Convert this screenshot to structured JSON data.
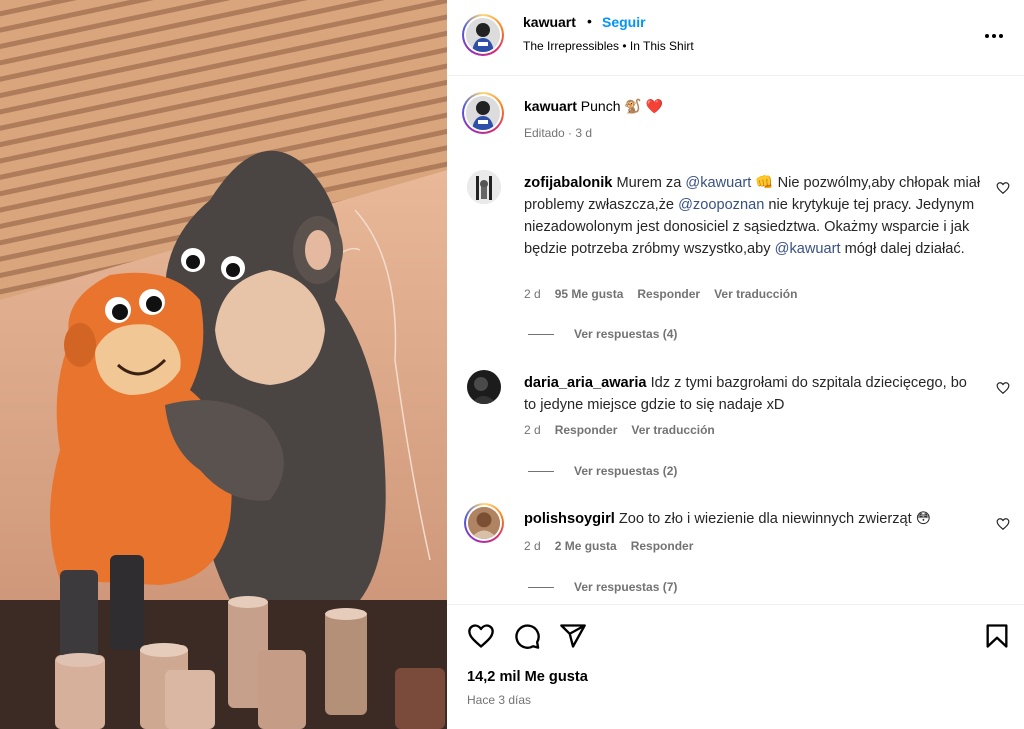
{
  "post": {
    "author": "kawuart",
    "follow_label": "Seguir",
    "separator": "•",
    "audio": "The Irrepressibles • In This Shirt",
    "more_icon": "more-horizontal-icon"
  },
  "caption": {
    "user": "kawuart",
    "text": " Punch 🐒 ❤️",
    "meta": "Editado · 3 d"
  },
  "comments": [
    {
      "user": "zofijabalonik",
      "segments": [
        {
          "t": " Murem za ",
          "m": false
        },
        {
          "t": "@kawuart",
          "m": true
        },
        {
          "t": " 👊 Nie pozwólmy,aby chłopak miał problemy zwłaszcza,że ",
          "m": false
        },
        {
          "t": "@zoopoznan",
          "m": true
        },
        {
          "t": " nie krytykuje tej pracy. Jedynym niezadowolonym jest donosiciel z sąsiedztwa. Okażmy wsparcie i jak będzie potrzeba zróbmy wszystko,aby ",
          "m": false
        },
        {
          "t": "@kawuart",
          "m": true
        },
        {
          "t": " mógł dalej działać.",
          "m": false
        }
      ],
      "time": "2 d",
      "likes": "95 Me gusta",
      "reply": "Responder",
      "translate": "Ver traducción",
      "replies": "Ver respuestas (4)"
    },
    {
      "user": "daria_aria_awaria",
      "segments": [
        {
          "t": " Idz z tymi bazgrołami do szpitala dziecięcego, bo to jedyne miejsce gdzie to się nadaje xD",
          "m": false
        }
      ],
      "time": "2 d",
      "likes": "",
      "reply": "Responder",
      "translate": "Ver traducción",
      "replies": "Ver respuestas (2)"
    },
    {
      "user": "polishsoygirl",
      "segments": [
        {
          "t": " Zoo to zło i wiezienie dla niewinnych zwierząt 😳",
          "m": false
        }
      ],
      "time": "2 d",
      "likes": "2 Me gusta",
      "reply": "Responder",
      "translate": "",
      "replies": "Ver respuestas (7)"
    }
  ],
  "footer": {
    "likes": "14,2 mil Me gusta",
    "time_ago": "Hace 3 días"
  },
  "colors": {
    "follow": "#0095f6",
    "mention": "#385185",
    "muted": "#737373"
  }
}
